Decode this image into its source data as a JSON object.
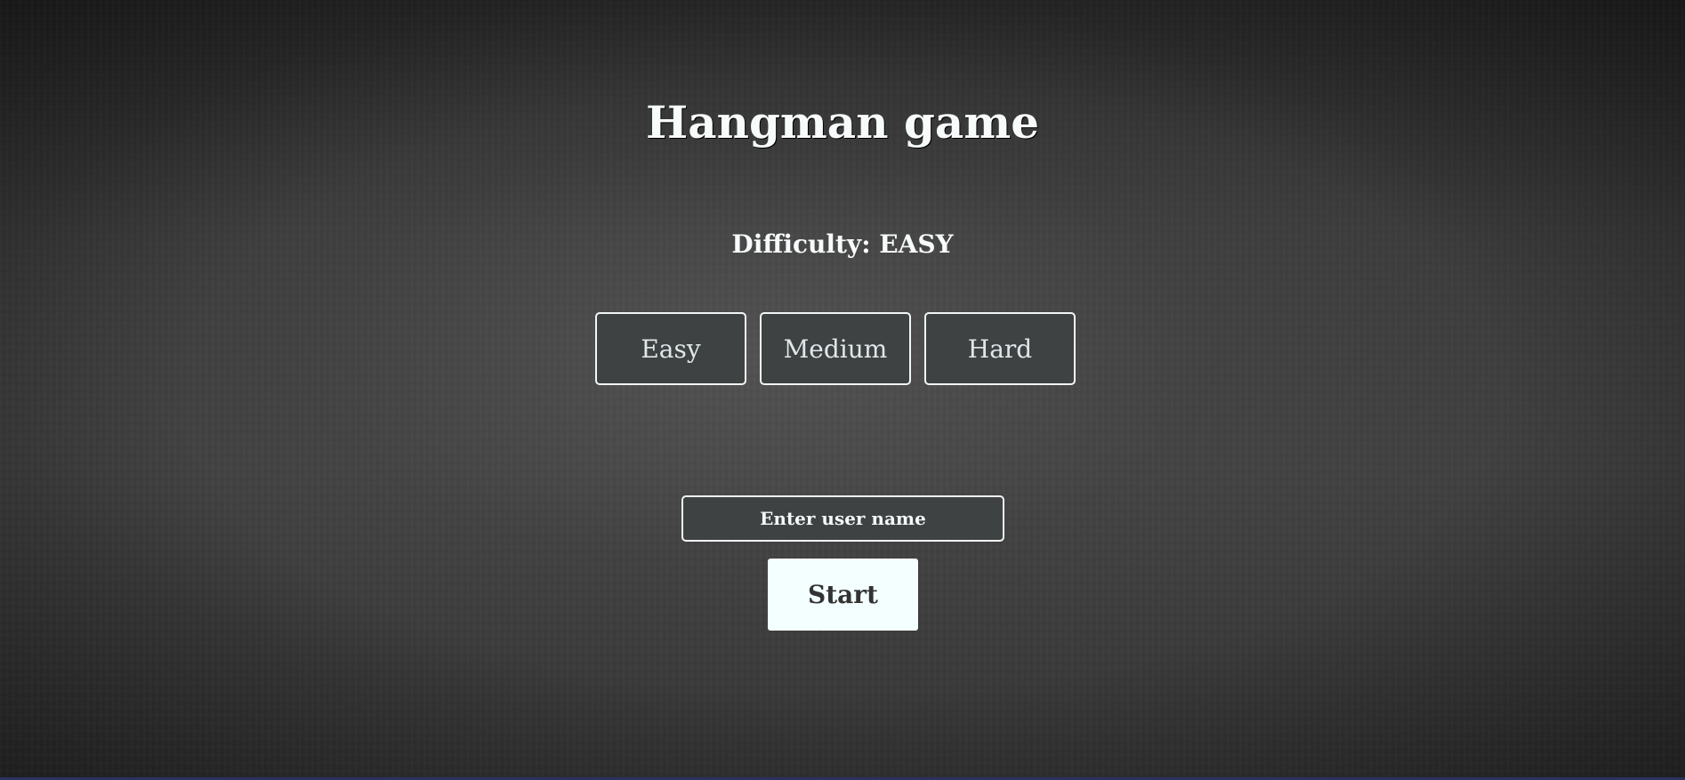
{
  "page": {
    "title": "Hangman game"
  },
  "difficulty": {
    "label": "Difficulty: EASY",
    "options": [
      {
        "label": "Easy"
      },
      {
        "label": "Medium"
      },
      {
        "label": "Hard"
      }
    ]
  },
  "form": {
    "username_placeholder": "Enter user name",
    "username_value": "",
    "start_label": "Start"
  },
  "colors": {
    "background": "#3a3a3a",
    "text": "#f4f8f8",
    "button_bg": "#3f4242",
    "start_bg": "#f4ffff"
  }
}
